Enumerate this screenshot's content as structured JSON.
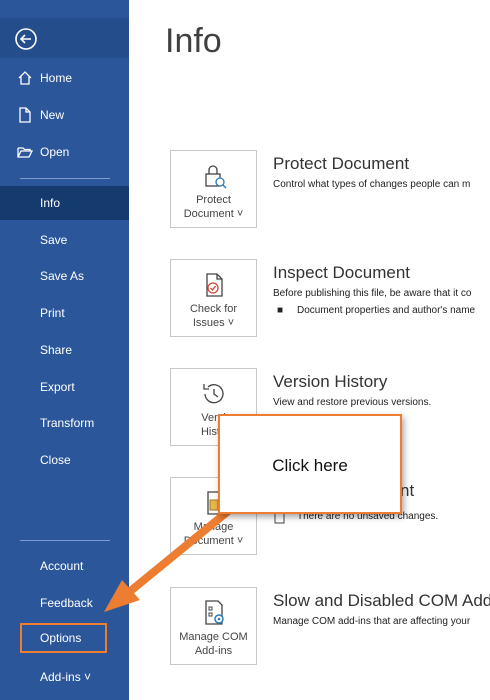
{
  "sidebar": {
    "items": [
      {
        "label": "Home"
      },
      {
        "label": "New"
      },
      {
        "label": "Open"
      },
      {
        "label": "Info"
      },
      {
        "label": "Save"
      },
      {
        "label": "Save As"
      },
      {
        "label": "Print"
      },
      {
        "label": "Share"
      },
      {
        "label": "Export"
      },
      {
        "label": "Transform"
      },
      {
        "label": "Close"
      },
      {
        "label": "Account"
      },
      {
        "label": "Feedback"
      },
      {
        "label": "Options"
      },
      {
        "label": "Add-ins ˅"
      }
    ],
    "background_color": "#2b579a",
    "active_color": "#143a6e"
  },
  "main": {
    "title": "Info",
    "sections": [
      {
        "button_label_1": "Protect",
        "button_label_2": "Document ˅",
        "title": "Protect Document",
        "description": "Control what types of changes people can m"
      },
      {
        "button_label_1": "Check for",
        "button_label_2": "Issues ˅",
        "title": "Inspect Document",
        "description": "Before publishing this file, be aware that it co",
        "bullet": "Document properties and author's name"
      },
      {
        "button_label_1": "Versi",
        "button_label_2": "Histo",
        "title": "Version History",
        "description": "View and restore previous versions."
      },
      {
        "button_label_1": "Manage",
        "button_label_2": "Document ˅",
        "title": "nt",
        "description": "There are no unsaved changes."
      },
      {
        "button_label_1": "Manage COM",
        "button_label_2": "Add-ins",
        "title": "Slow and Disabled COM Add",
        "description": "Manage COM add-ins that are affecting your"
      }
    ]
  },
  "callout": {
    "text": "Click here",
    "accent_color": "#ed7d31"
  }
}
